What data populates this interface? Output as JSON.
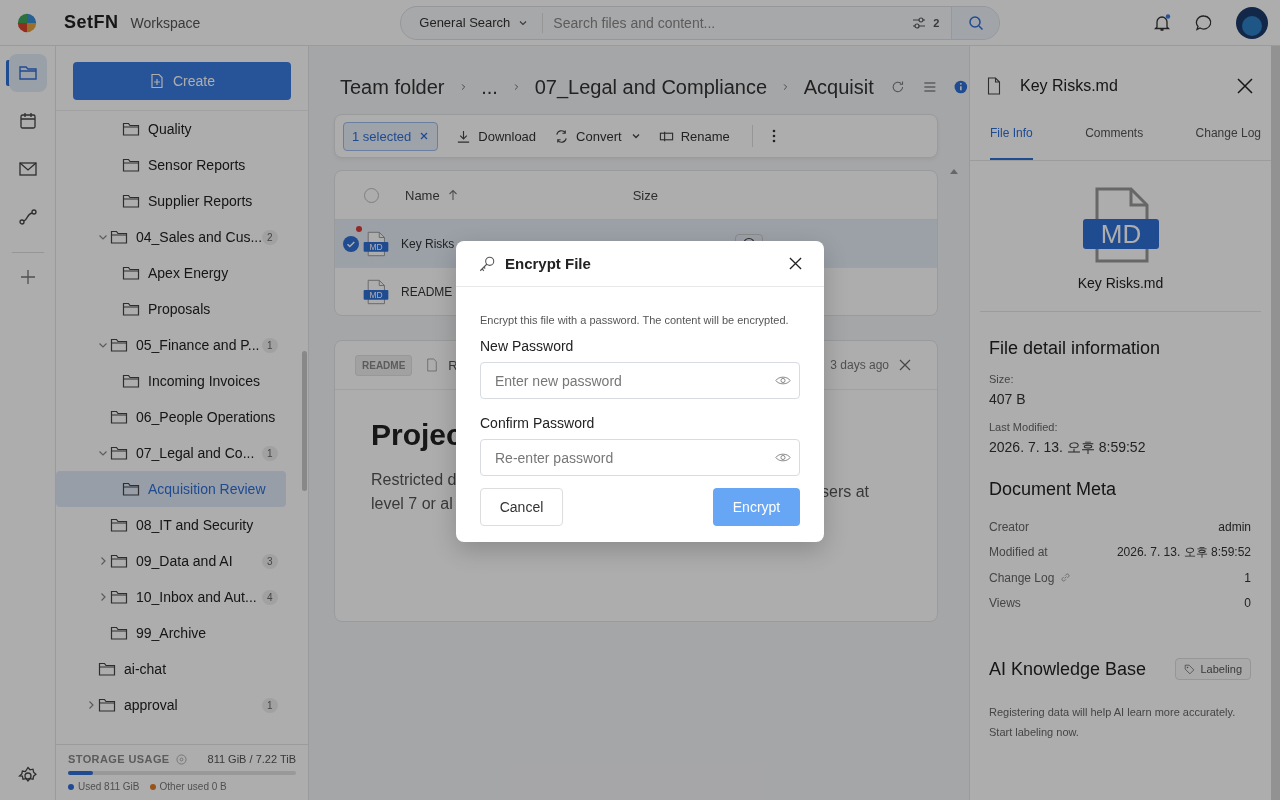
{
  "app": {
    "brand": "SetFN",
    "workspace": "Workspace"
  },
  "search": {
    "scope": "General Search",
    "placeholder": "Search files and content...",
    "filter_count": "2"
  },
  "header": {
    "notifications_unread": true
  },
  "rail": [
    {
      "kind": "folder",
      "selected": true
    },
    {
      "kind": "calendar",
      "selected": false
    },
    {
      "kind": "mail",
      "selected": false
    },
    {
      "kind": "flow",
      "selected": false
    }
  ],
  "sidebar": {
    "create_label": "Create",
    "tree": [
      {
        "children": [
          {
            "children": [
              {
                "label": "Quality",
                "selected": false
              },
              {
                "label": "Sensor Reports",
                "selected": false
              },
              {
                "label": "Supplier Reports",
                "selected": false
              }
            ]
          },
          {
            "label": "04_Sales and Cus...",
            "count": "2",
            "expanded": true,
            "selected": false,
            "children": [
              {
                "label": "Apex Energy",
                "selected": false
              },
              {
                "label": "Proposals",
                "selected": false
              }
            ]
          },
          {
            "label": "05_Finance and P...",
            "count": "1",
            "expanded": true,
            "selected": false,
            "children": [
              {
                "label": "Incoming Invoices",
                "selected": false
              }
            ]
          },
          {
            "label": "06_People Operations",
            "selected": false
          },
          {
            "label": "07_Legal and Co...",
            "count": "1",
            "expanded": true,
            "selected": false,
            "children": [
              {
                "label": "Acquisition Review",
                "selected": true
              }
            ]
          },
          {
            "label": "08_IT and Security",
            "selected": false
          },
          {
            "label": "09_Data and AI",
            "count": "3",
            "expanded": false,
            "selected": false
          },
          {
            "label": "10_Inbox and Aut...",
            "count": "4",
            "expanded": false,
            "selected": false
          },
          {
            "label": "99_Archive",
            "selected": false
          }
        ]
      },
      {
        "label": "ai-chat",
        "selected": false
      },
      {
        "label": "approval",
        "count": "1",
        "expanded": false,
        "selected": false
      }
    ],
    "storage": {
      "title": "STORAGE USAGE",
      "reading": "811 GiB / 7.22 TiB",
      "level": 0.11,
      "legend": [
        {
          "label": "Used 811 GiB",
          "color": "#204b92"
        },
        {
          "label": "Other used 0 B",
          "color": "#985418"
        }
      ]
    }
  },
  "breadcrumb": [
    "Team folder",
    "...",
    "07_Legal and Compliance",
    "Acquisit"
  ],
  "toolbar": {
    "selection": "1 selected",
    "actions": [
      {
        "kind": "download",
        "label": "Download"
      },
      {
        "kind": "convert",
        "label": "Convert"
      },
      {
        "kind": "rename",
        "label": "Rename"
      }
    ]
  },
  "table": {
    "columns": [
      "Name",
      "Size"
    ],
    "all_selected": false,
    "rows": [
      {
        "name": "Key Risks",
        "type": "MD",
        "selected": true,
        "unread": true,
        "history": true
      },
      {
        "name": "README",
        "type": "MD",
        "selected": false,
        "unread": false,
        "history": false
      }
    ]
  },
  "readme": {
    "badge": "README",
    "file": "R",
    "time": "3 days ago",
    "heading": "Projec",
    "lines_left": [
      "Restricted d",
      "level 7 or al"
    ],
    "lines_right": [
      "sers at"
    ]
  },
  "details": {
    "file": "Key Risks.md",
    "tabs": [
      {
        "label": "File Info",
        "selected": true
      },
      {
        "label": "Comments",
        "selected": false
      },
      {
        "label": "Change Log",
        "selected": false
      }
    ],
    "type_badge": "MD",
    "name": "Key Risks.md",
    "section_title": "File detail information",
    "fields": [
      {
        "label": "Size:",
        "value": "407 B"
      },
      {
        "label": "Last Modified:",
        "value": "2026. 7. 13. 오후 8:59:52"
      }
    ],
    "meta_title": "Document Meta",
    "meta": [
      {
        "label": "Creator",
        "value": "admin",
        "linked": false
      },
      {
        "label": "Modified at",
        "value": "2026. 7. 13. 오후 8:59:52",
        "linked": false
      },
      {
        "label": "Change Log",
        "value": "1",
        "linked": true
      },
      {
        "label": "Views",
        "value": "0",
        "linked": false
      }
    ],
    "ai_title": "AI Knowledge Base",
    "labeling": "Labeling",
    "ai_note": "Registering data will help AI learn more accurately. Start labeling now."
  },
  "dialog": {
    "title": "Encrypt File",
    "description": "Encrypt this file with a password. The content will be encrypted.",
    "fields": [
      {
        "label": "New Password",
        "placeholder": "Enter new password"
      },
      {
        "label": "Confirm Password",
        "placeholder": "Re-enter password"
      }
    ],
    "cancel": "Cancel",
    "confirm": "Encrypt",
    "confirm_disabled": true
  }
}
